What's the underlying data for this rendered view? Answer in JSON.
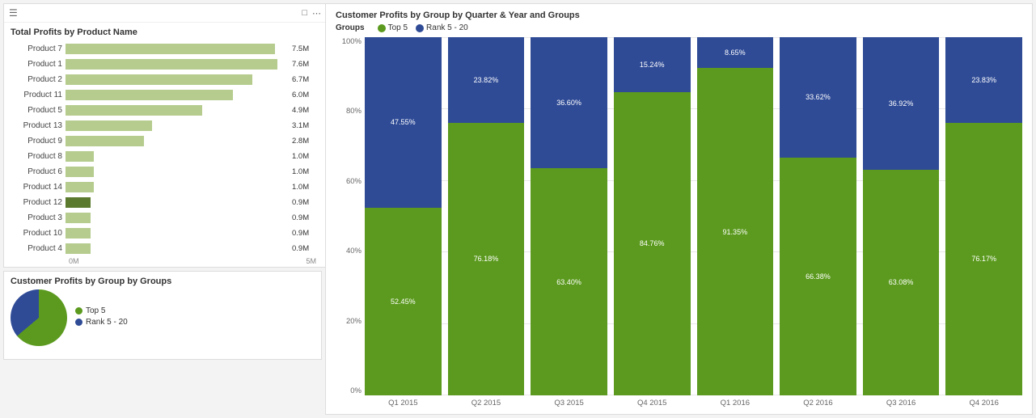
{
  "leftChart": {
    "title": "Total Profits by Product Name",
    "bars": [
      {
        "label": "Product 7",
        "value": "7.5M",
        "pct": 100,
        "dark": false
      },
      {
        "label": "Product 1",
        "value": "7.6M",
        "pct": 99,
        "dark": false
      },
      {
        "label": "Product 2",
        "value": "6.7M",
        "pct": 87,
        "dark": false
      },
      {
        "label": "Product 11",
        "value": "6.0M",
        "pct": 78,
        "dark": false
      },
      {
        "label": "Product 5",
        "value": "4.9M",
        "pct": 63,
        "dark": false
      },
      {
        "label": "Product 13",
        "value": "3.1M",
        "pct": 40,
        "dark": false
      },
      {
        "label": "Product 9",
        "value": "2.8M",
        "pct": 36,
        "dark": false
      },
      {
        "label": "Product 8",
        "value": "1.0M",
        "pct": 12,
        "dark": false
      },
      {
        "label": "Product 6",
        "value": "1.0M",
        "pct": 12,
        "dark": false
      },
      {
        "label": "Product 14",
        "value": "1.0M",
        "pct": 12,
        "dark": false
      },
      {
        "label": "Product 12",
        "value": "0.9M",
        "pct": 11,
        "dark": true
      },
      {
        "label": "Product 3",
        "value": "0.9M",
        "pct": 11,
        "dark": false
      },
      {
        "label": "Product 10",
        "value": "0.9M",
        "pct": 11,
        "dark": false
      },
      {
        "label": "Product 4",
        "value": "0.9M",
        "pct": 11,
        "dark": false
      }
    ],
    "axisMin": "0M",
    "axisMax": "5M"
  },
  "rightChart": {
    "title": "Customer Profits by Group by Quarter & Year and Groups",
    "legendLabel": "Groups",
    "legendItems": [
      {
        "label": "Top 5",
        "color": "#5b9a1e"
      },
      {
        "label": "Rank 5 - 20",
        "color": "#2f4b96"
      }
    ],
    "yAxis": [
      "100%",
      "80%",
      "60%",
      "40%",
      "20%",
      "0%"
    ],
    "columns": [
      {
        "quarter": "Q1 2015",
        "blue": 47.55,
        "green": 52.45
      },
      {
        "quarter": "Q2 2015",
        "blue": 23.82,
        "green": 76.18
      },
      {
        "quarter": "Q3 2015",
        "blue": 36.6,
        "green": 63.4
      },
      {
        "quarter": "Q4 2015",
        "blue": 15.24,
        "green": 84.76
      },
      {
        "quarter": "Q1 2016",
        "blue": 8.65,
        "green": 91.35
      },
      {
        "quarter": "Q2 2016",
        "blue": 33.62,
        "green": 66.38
      },
      {
        "quarter": "Q3 2016",
        "blue": 36.92,
        "green": 63.08
      },
      {
        "quarter": "Q4 2016",
        "blue": 23.83,
        "green": 76.17
      }
    ]
  },
  "bottomLeft": {
    "title": "Customer Profits by Group by Groups",
    "legendItems": [
      {
        "label": "Top 5",
        "color": "#5b9a1e"
      },
      {
        "label": "Rank 5 - 20",
        "color": "#2f4b96"
      }
    ]
  }
}
